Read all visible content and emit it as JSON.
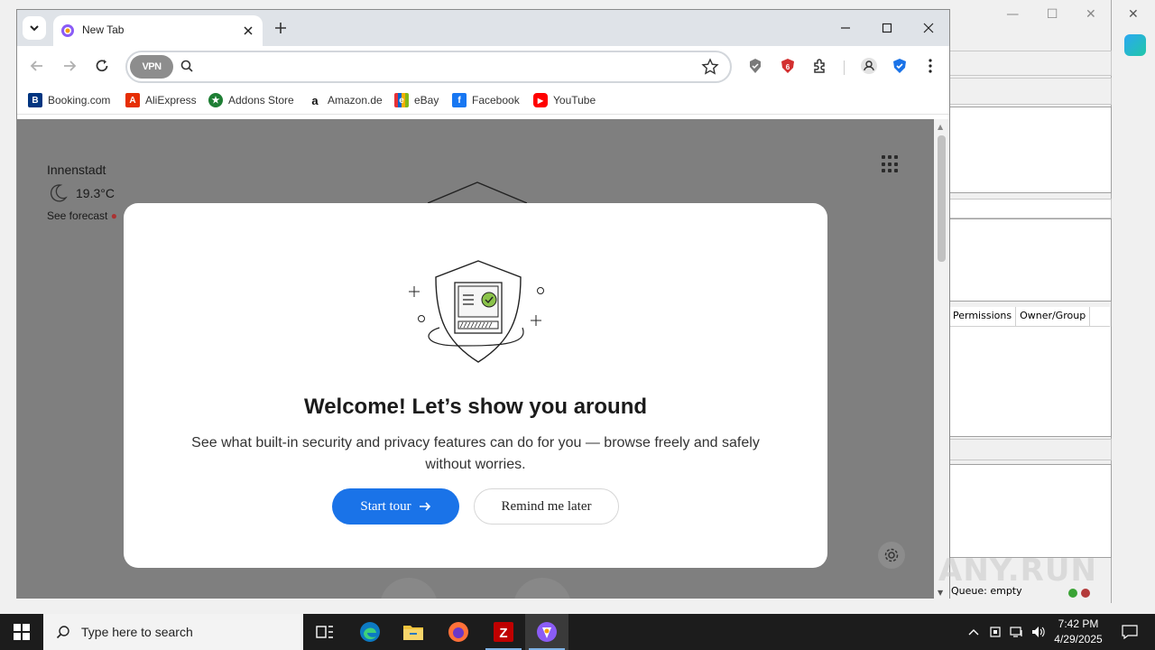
{
  "browser": {
    "tab_title": "New Tab",
    "omnibox_placeholder": "",
    "vpn_label": "VPN",
    "bookmarks": [
      {
        "label": "Booking.com",
        "icon": "booking-icon",
        "color": "#003580",
        "glyph": "B"
      },
      {
        "label": "AliExpress",
        "icon": "aliexpress-icon",
        "color": "#e62e04",
        "glyph": "A"
      },
      {
        "label": "Addons Store",
        "icon": "addons-store-icon",
        "color": "#1e7e34",
        "glyph": "★"
      },
      {
        "label": "Amazon.de",
        "icon": "amazon-icon",
        "color": "#ffffff",
        "glyph": "a"
      },
      {
        "label": "eBay",
        "icon": "ebay-icon",
        "color": "#ffffff",
        "glyph": "e"
      },
      {
        "label": "Facebook",
        "icon": "facebook-icon",
        "color": "#1877f2",
        "glyph": "f"
      },
      {
        "label": "YouTube",
        "icon": "youtube-icon",
        "color": "#ff0000",
        "glyph": "▶"
      }
    ]
  },
  "page": {
    "weather": {
      "city": "Innenstadt",
      "temperature": "19.3°C",
      "forecast_link": "See forecast"
    }
  },
  "modal": {
    "title": "Welcome! Let’s show you around",
    "description": "See what built-in security and privacy features can do for you — browse freely and safely without worries.",
    "start_button": "Start tour",
    "remind_button": "Remind me later"
  },
  "background_app": {
    "columns": [
      "Permissions",
      "Owner/Group"
    ],
    "status": "Queue: empty"
  },
  "watermark": "ANY.RUN",
  "taskbar": {
    "search_placeholder": "Type here to search",
    "time": "7:42 PM",
    "date": "4/29/2025"
  },
  "colors": {
    "accent": "#1a73e8",
    "overlay": "#7f7f7f",
    "taskbar": "#1c1c1c"
  }
}
